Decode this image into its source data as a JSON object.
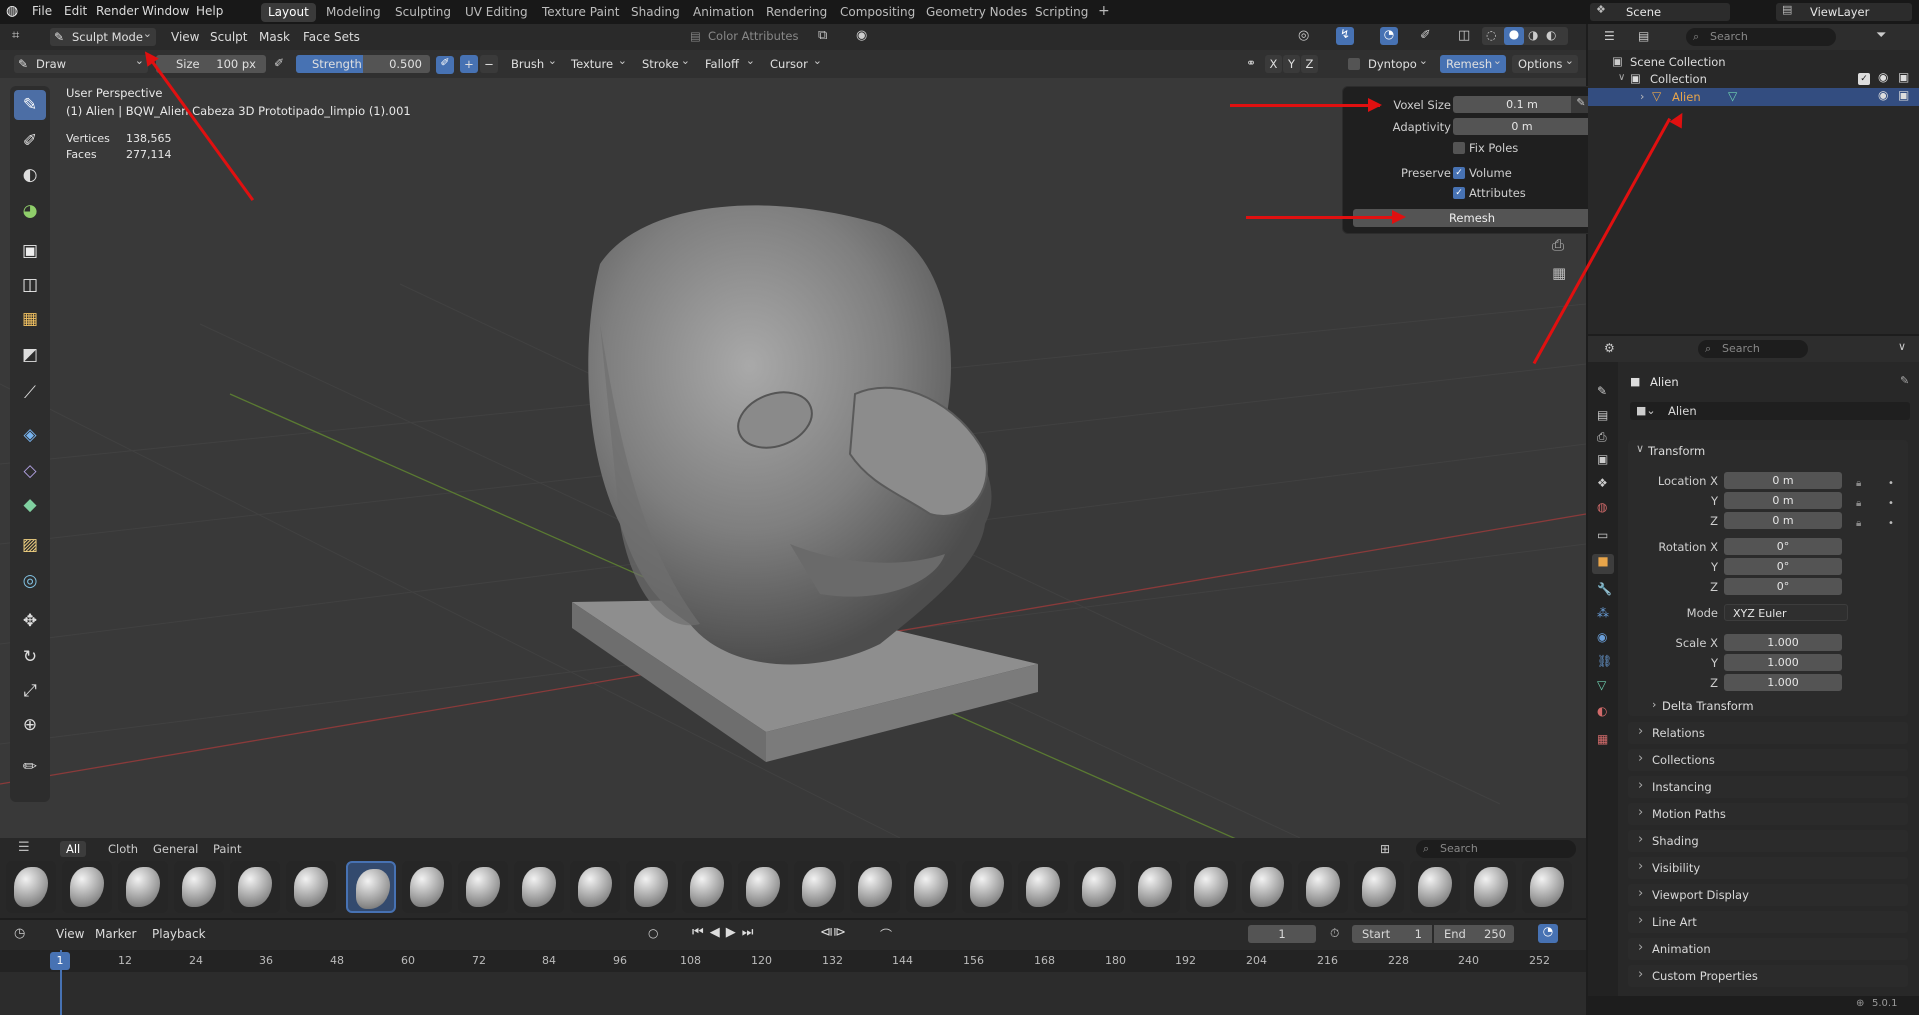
{
  "topbar": {
    "menus": [
      "File",
      "Edit",
      "Render",
      "Window",
      "Help"
    ],
    "workspaces": [
      "Layout",
      "Modeling",
      "Sculpting",
      "UV Editing",
      "Texture Paint",
      "Shading",
      "Animation",
      "Rendering",
      "Compositing",
      "Geometry Nodes",
      "Scripting"
    ],
    "active_workspace": "Layout",
    "scene": "Scene",
    "view_layer": "ViewLayer"
  },
  "viewport_header": {
    "mode": "Sculpt Mode",
    "menus": [
      "View",
      "Sculpt",
      "Mask",
      "Face Sets"
    ],
    "color_attributes": "Color Attributes"
  },
  "tool_header": {
    "tool": "Draw",
    "size_label": "Size",
    "size_value": "100 px",
    "strength_label": "Strength",
    "strength_value": "0.500",
    "plus": "+",
    "minus": "−",
    "dropdowns": [
      "Brush",
      "Texture",
      "Stroke",
      "Falloff",
      "Cursor"
    ],
    "axes": [
      "X",
      "Y",
      "Z"
    ],
    "dyntopo": "Dyntopo",
    "remesh": "Remesh",
    "options": "Options"
  },
  "overlay": {
    "view_name": "User Perspective",
    "object_name": "(1) Alien | BQW_Alien Cabeza 3D Prototipado_limpio (1).001",
    "vertices_label": "Vertices",
    "vertices_value": "138,565",
    "faces_label": "Faces",
    "faces_value": "277,114"
  },
  "remesh_popover": {
    "voxel_size_label": "Voxel Size",
    "voxel_size_value": "0.1 m",
    "adaptivity_label": "Adaptivity",
    "adaptivity_value": "0 m",
    "fix_poles": "Fix Poles",
    "preserve_label": "Preserve",
    "volume": "Volume",
    "attributes": "Attributes",
    "remesh_button": "Remesh"
  },
  "asset_shelf": {
    "tabs": [
      "All",
      "Cloth",
      "General",
      "Paint"
    ],
    "active_tab": "All",
    "search_placeholder": "Search"
  },
  "outliner": {
    "search_placeholder": "Search",
    "scene_collection": "Scene Collection",
    "collection": "Collection",
    "object": "Alien"
  },
  "properties": {
    "search_placeholder": "Search",
    "object_title": "Alien",
    "object_name": "Alien",
    "transform_label": "Transform",
    "location_x_label": "Location X",
    "y_label": "Y",
    "z_label": "Z",
    "location": [
      "0 m",
      "0 m",
      "0 m"
    ],
    "rotation_x_label": "Rotation X",
    "rotation": [
      "0°",
      "0°",
      "0°"
    ],
    "mode_label": "Mode",
    "mode_value": "XYZ Euler",
    "scale_x_label": "Scale X",
    "scale": [
      "1.000",
      "1.000",
      "1.000"
    ],
    "delta_transform": "Delta Transform",
    "sections": [
      "Relations",
      "Collections",
      "Instancing",
      "Motion Paths",
      "Shading",
      "Visibility",
      "Viewport Display",
      "Line Art",
      "Animation",
      "Custom Properties"
    ]
  },
  "timeline": {
    "menus": [
      "View",
      "Marker",
      "Playback"
    ],
    "current_frame": "1",
    "start_label": "Start",
    "start_value": "1",
    "end_label": "End",
    "end_value": "250",
    "ticks": [
      "1",
      "12",
      "24",
      "36",
      "48",
      "60",
      "72",
      "84",
      "96",
      "108",
      "120",
      "132",
      "144",
      "156",
      "168",
      "180",
      "192",
      "204",
      "216",
      "228",
      "240",
      "252"
    ]
  },
  "status": {
    "version": "5.0.1"
  },
  "colors": {
    "accent": "#4772b3",
    "annotation": "#e01010",
    "object_orange": "#e8a54a"
  }
}
